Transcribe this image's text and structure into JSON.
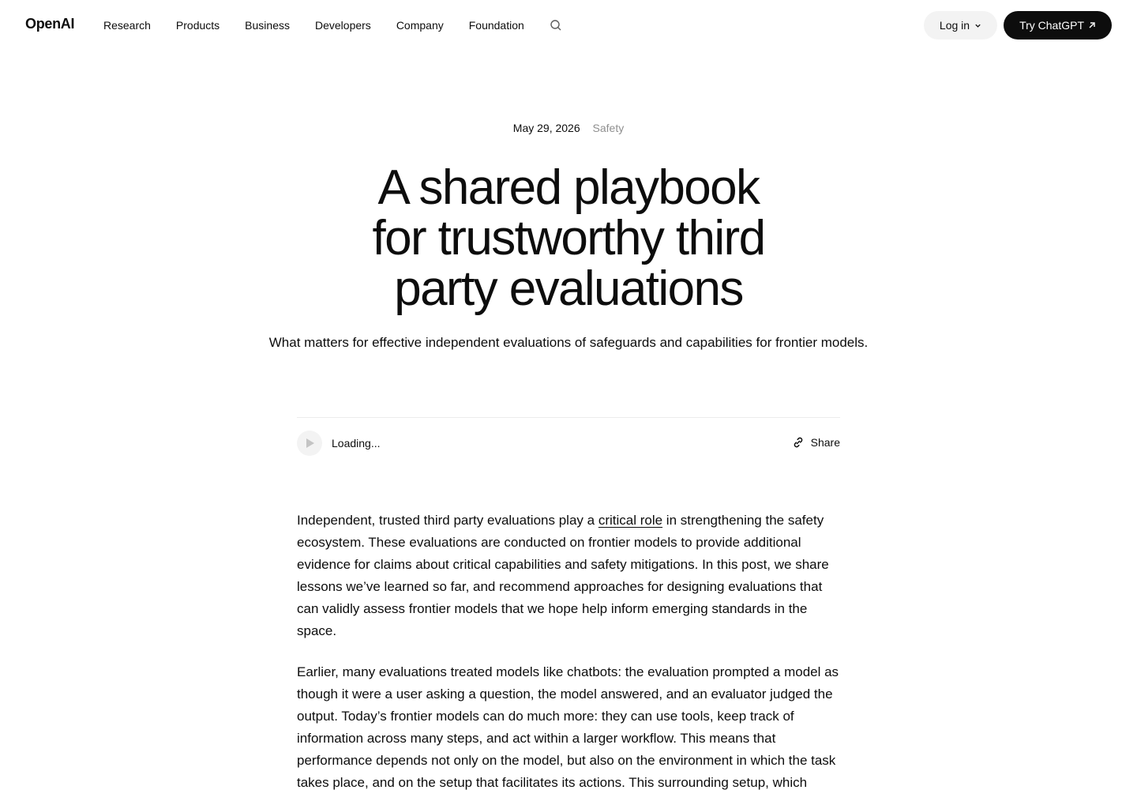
{
  "brand": {
    "logo_text": "OpenAI"
  },
  "nav": {
    "items": [
      {
        "label": "Research"
      },
      {
        "label": "Products"
      },
      {
        "label": "Business"
      },
      {
        "label": "Developers"
      },
      {
        "label": "Company"
      },
      {
        "label": "Foundation"
      }
    ],
    "search_icon": "search-icon"
  },
  "header_actions": {
    "login_label": "Log in",
    "try_label": "Try ChatGPT"
  },
  "article_meta": {
    "date": "May 29, 2026",
    "tag": "Safety"
  },
  "hero": {
    "title_lines": [
      "A shared playbook",
      "for trustworthy third",
      "party evaluations"
    ],
    "subtitle": "What matters for effective independent evaluations of safeguards and capabilities for frontier models."
  },
  "audio": {
    "status": "Loading...",
    "share_label": "Share"
  },
  "body": {
    "p1_before": "Independent, trusted third party evaluations play a ",
    "p1_link": "critical role",
    "p1_after": " in strengthening the safety ecosystem. These evaluations are conducted on frontier models to provide additional evidence for claims about critical capabilities and safety mitigations. In this post, we share lessons we’ve learned so far, and recommend approaches for designing evaluations that can validly assess frontier models that we hope help inform emerging standards in the space.",
    "p2": "Earlier, many evaluations treated models like chatbots: the evaluation prompted a model as though it were a user asking a question, the model answered, and an evaluator judged the output. Today’s frontier models can do much more: they can use tools, keep track of information across many steps, and act within a larger workflow. This means that performance depends not only on the model, but also on the environment in which the task takes place, and on the setup that facilitates its actions. This surrounding setup, which"
  },
  "colors": {
    "text": "#0d0d0d",
    "muted": "#8f8f8f",
    "pill_bg": "#f3f3f3",
    "cta_bg": "#0d0d0d",
    "divider": "#ececec"
  }
}
